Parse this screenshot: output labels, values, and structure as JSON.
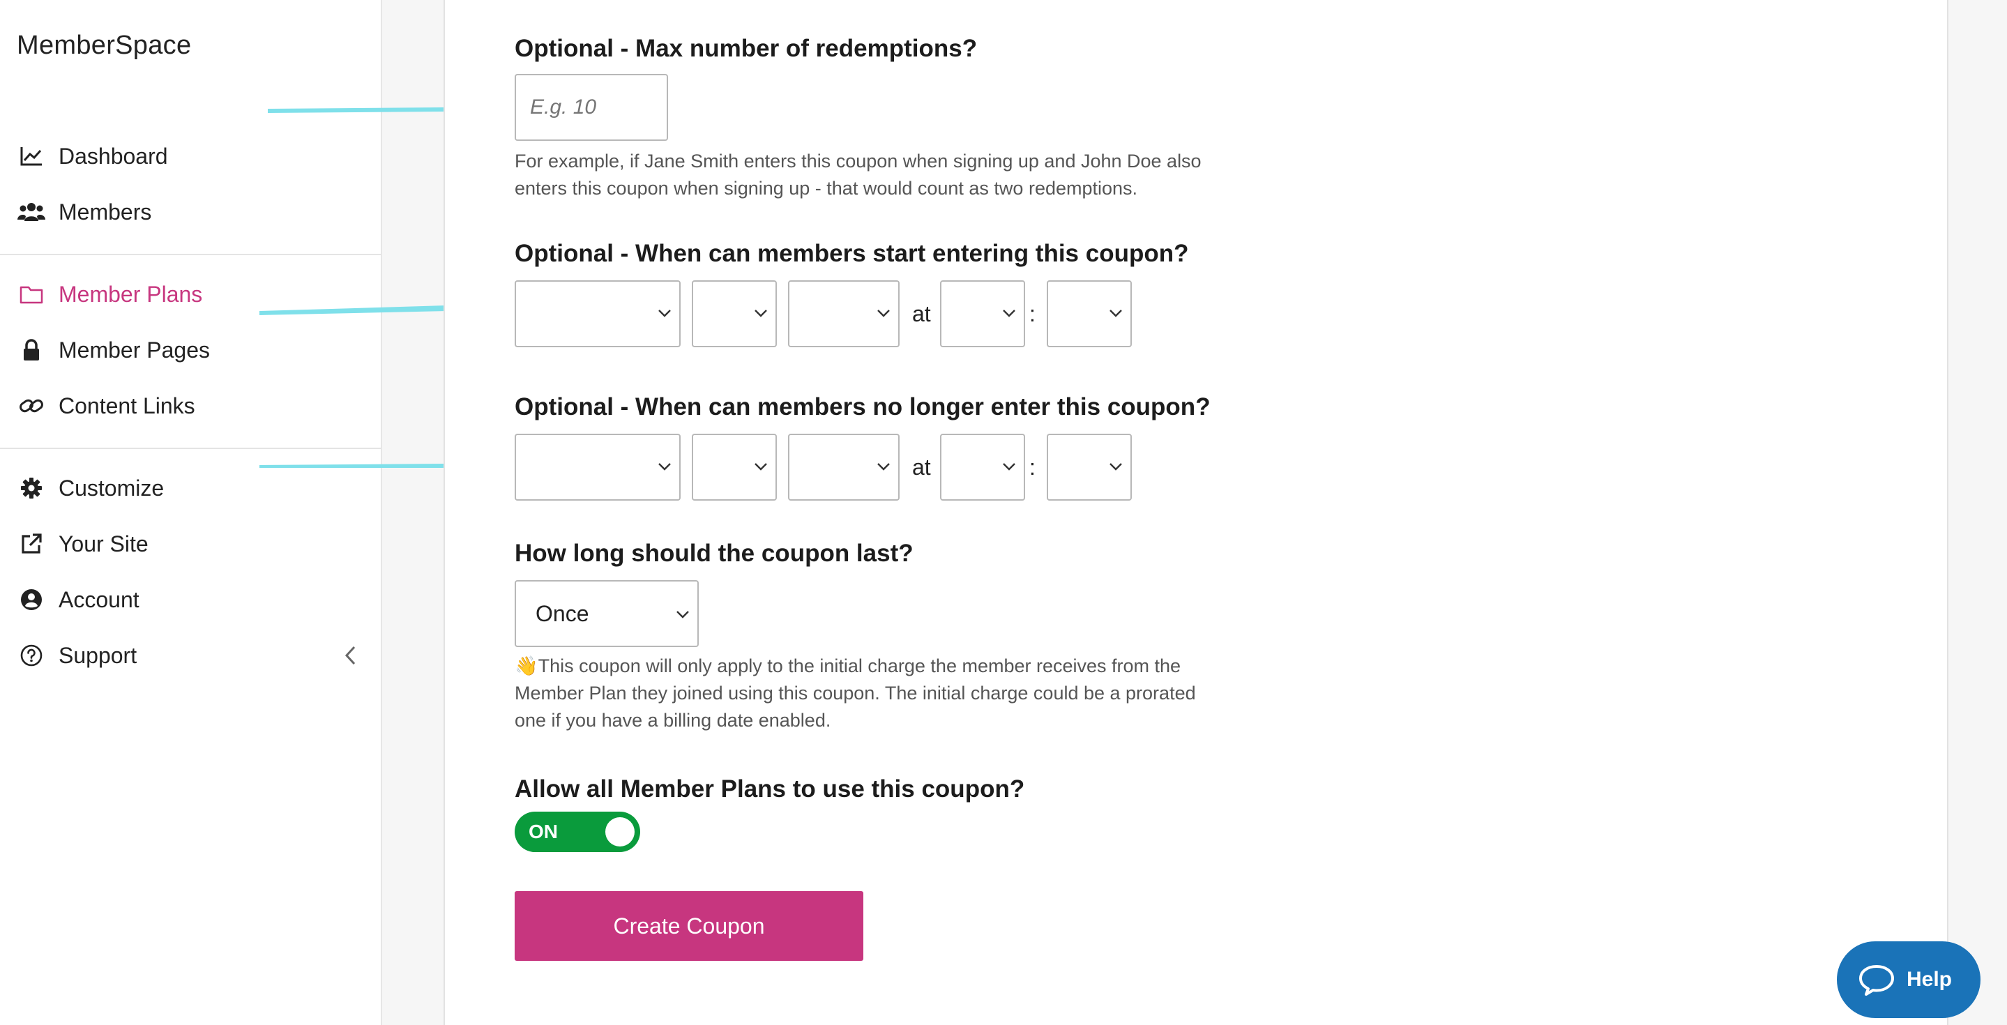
{
  "app": {
    "logo_text": "MemberSpace"
  },
  "sidebar": {
    "items": [
      {
        "label": "Dashboard",
        "icon": "chart-line-icon"
      },
      {
        "label": "Members",
        "icon": "users-icon"
      },
      {
        "label": "Member Plans",
        "icon": "folder-icon",
        "active": true
      },
      {
        "label": "Member Pages",
        "icon": "lock-icon"
      },
      {
        "label": "Content Links",
        "icon": "link-icon"
      },
      {
        "label": "Customize",
        "icon": "gear-icon"
      },
      {
        "label": "Your Site",
        "icon": "external-link-icon"
      },
      {
        "label": "Account",
        "icon": "user-circle-icon"
      },
      {
        "label": "Support",
        "icon": "question-circle-icon"
      }
    ]
  },
  "form": {
    "max_redemptions": {
      "label": "Optional - Max number of redemptions?",
      "placeholder": "E.g. 10",
      "value": "",
      "help": "For example, if Jane Smith enters this coupon when signing up and John Doe also enters this coupon when signing up - that would count as two redemptions."
    },
    "start": {
      "label": "Optional - When can members start entering this coupon?",
      "at_text": "at",
      "colon": ":"
    },
    "end": {
      "label": "Optional - When can members no longer enter this coupon?",
      "at_text": "at",
      "colon": ":"
    },
    "duration": {
      "label": "How long should the coupon last?",
      "selected": "Once",
      "help": "👋This coupon will only apply to the initial charge the member receives from the Member Plan they joined using this coupon. The initial charge could be a prorated one if you have a billing date enabled."
    },
    "allow_all_plans": {
      "label": "Allow all Member Plans to use this coupon?",
      "toggle_text": "ON",
      "on": true
    },
    "submit_label": "Create Coupon"
  },
  "help_widget": {
    "label": "Help"
  },
  "colors": {
    "accent": "#c7367f",
    "toggle_on": "#0a9b3c",
    "help_button": "#1a73b8",
    "arrow": "#7fe0ea"
  }
}
